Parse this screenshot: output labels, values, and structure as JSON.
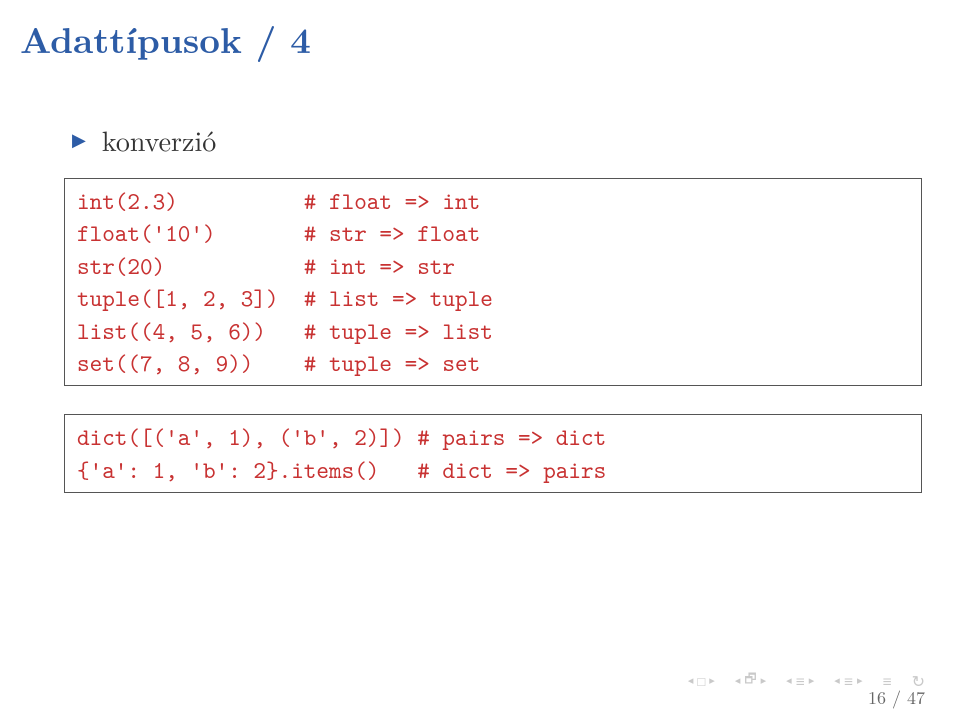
{
  "title": "Adattípusok / 4",
  "bullet": "konverzió",
  "code_block_1": "int(2.3)          # float => int\nfloat('10')       # str => float\nstr(20)           # int => str\ntuple([1, 2, 3])  # list => tuple\nlist((4, 5, 6))   # tuple => list\nset((7, 8, 9))    # tuple => set",
  "code_block_2": "dict([('a', 1), ('b', 2)]) # pairs => dict\n{'a': 1, 'b': 2}.items()   # dict => pairs",
  "page_number": "16 / 47",
  "nav": {
    "sym_square": "□",
    "sym_frame": "🗗",
    "sym_bar": "≡"
  }
}
